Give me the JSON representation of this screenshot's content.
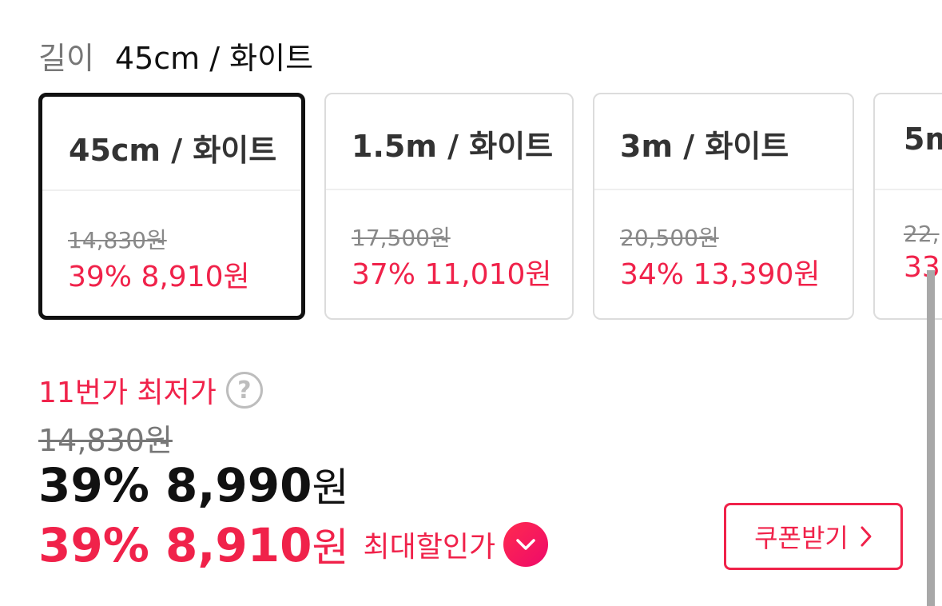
{
  "option_header": {
    "key": "길이",
    "value": "45cm / 화이트"
  },
  "options": [
    {
      "title": "45cm / 화이트",
      "original_price": "14,830원",
      "sale": "39% 8,910원",
      "selected": true
    },
    {
      "title": "1.5m / 화이트",
      "original_price": "17,500원",
      "sale": "37% 11,010원",
      "selected": false
    },
    {
      "title": "3m / 화이트",
      "original_price": "20,500원",
      "sale": "34% 13,390원",
      "selected": false
    },
    {
      "title": "5m",
      "original_price": "22,",
      "sale": "33",
      "selected": false
    }
  ],
  "price": {
    "lowest_label": "11번가 최저가",
    "help_icon_glyph": "?",
    "original": "14,830원",
    "main_discount_amount": "39% 8,990",
    "main_unit": "원",
    "max_discount_amount": "39% 8,910",
    "max_unit": "원",
    "max_label": "최대할인가"
  },
  "coupon_button": {
    "label": "쿠폰받기"
  },
  "colors": {
    "accent": "#f0224a",
    "selected_border": "#111111",
    "card_border": "#dcdcdc"
  },
  "icons": {
    "help": "question-circle-icon",
    "expand": "chevron-down-icon",
    "coupon_arrow": "chevron-right-icon"
  }
}
